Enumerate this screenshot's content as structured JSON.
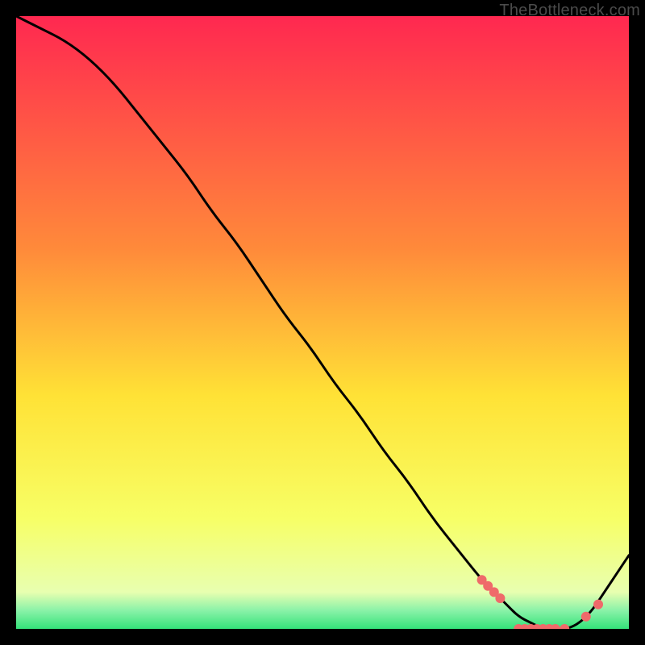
{
  "attribution": "TheBottleneck.com",
  "colors": {
    "black": "#000000",
    "curve": "#000000",
    "dots": "#ef6a6a",
    "text": "#4b4b4b",
    "grad_top": "#ff2850",
    "grad_mid1": "#ff8a3a",
    "grad_mid2": "#ffe236",
    "grad_low": "#f7ff66",
    "grad_green": "#34e27a"
  },
  "chart_data": {
    "type": "line",
    "title": "",
    "xlabel": "",
    "ylabel": "",
    "xlim": [
      0,
      100
    ],
    "ylim": [
      0,
      100
    ],
    "series": [
      {
        "name": "bottleneck-curve",
        "x": [
          0,
          4,
          8,
          12,
          16,
          20,
          24,
          28,
          32,
          36,
          40,
          44,
          48,
          52,
          56,
          60,
          64,
          68,
          72,
          76,
          78,
          80,
          82,
          84,
          86,
          88,
          90,
          92,
          94,
          96,
          98,
          100
        ],
        "y": [
          100,
          98,
          96,
          93,
          89,
          84,
          79,
          74,
          68,
          63,
          57,
          51,
          46,
          40,
          35,
          29,
          24,
          18,
          13,
          8,
          6,
          4,
          2,
          1,
          0,
          0,
          0,
          1,
          3,
          6,
          9,
          12
        ]
      }
    ],
    "markers": {
      "name": "highlight-points",
      "x": [
        76,
        77,
        78,
        79,
        82,
        83,
        84,
        85,
        86,
        87,
        88,
        89.5,
        93,
        95
      ],
      "y": [
        8,
        7,
        6,
        5,
        0,
        0,
        0,
        0,
        0,
        0,
        0,
        0,
        2,
        4
      ]
    }
  }
}
